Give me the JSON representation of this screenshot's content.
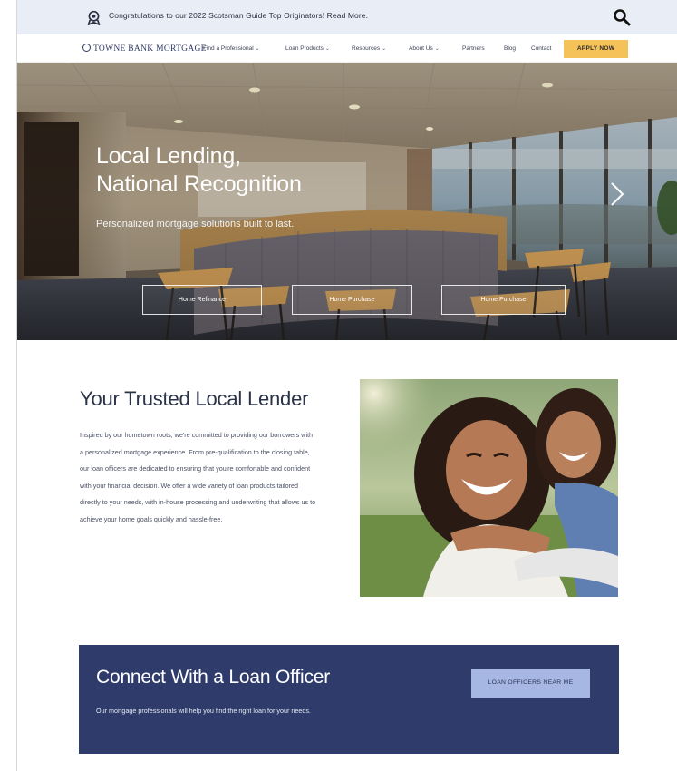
{
  "announcement": {
    "message": "Congratulations to our 2022 Scotsman Guide Top Originators!  Read More.",
    "icons": {
      "award": "award-ribbon-icon",
      "search": "search-icon"
    }
  },
  "nav": {
    "logo_text": "TOWNE BANK MORTGAGE",
    "items": [
      {
        "label": "Find a Professional",
        "has_dropdown": true
      },
      {
        "label": "Loan Products",
        "has_dropdown": true
      },
      {
        "label": "Resources",
        "has_dropdown": true
      },
      {
        "label": "About Us",
        "has_dropdown": true
      },
      {
        "label": "Partners",
        "has_dropdown": false
      },
      {
        "label": "Blog",
        "has_dropdown": false
      },
      {
        "label": "Contact",
        "has_dropdown": false
      }
    ],
    "apply_label": "APPLY NOW"
  },
  "hero": {
    "title_line1": "Local Lending,",
    "title_line2": "National Recognition",
    "subtitle": "Personalized mortgage solutions built to last.",
    "buttons": [
      "Home Refinance",
      "Home Purchase",
      "Home Purchase"
    ]
  },
  "trusted": {
    "title": "Your Trusted Local Lender",
    "body": "Inspired by our hometown roots, we're committed to providing our borrowers with a personalized mortgage experience. From pre-qualification to the closing table, our loan officers are dedicated to ensuring that you're comfortable and confident with your financial decision. We offer a wide variety of loan products tailored directly to your needs, with in-house processing and underwriting that allows us to achieve your home goals quickly and hassle-free."
  },
  "connect": {
    "title": "Connect With a Loan Officer",
    "body": "Our mortgage professionals will help you find the right loan for your needs.",
    "button_label": "LOAN OFFICERS NEAR ME"
  },
  "colors": {
    "announce_bg": "#e9edf5",
    "apply_bg": "#f5c25a",
    "navy": "#2f3c6b",
    "connect_button": "#a6b7e4",
    "heading_text": "#2b3348"
  }
}
